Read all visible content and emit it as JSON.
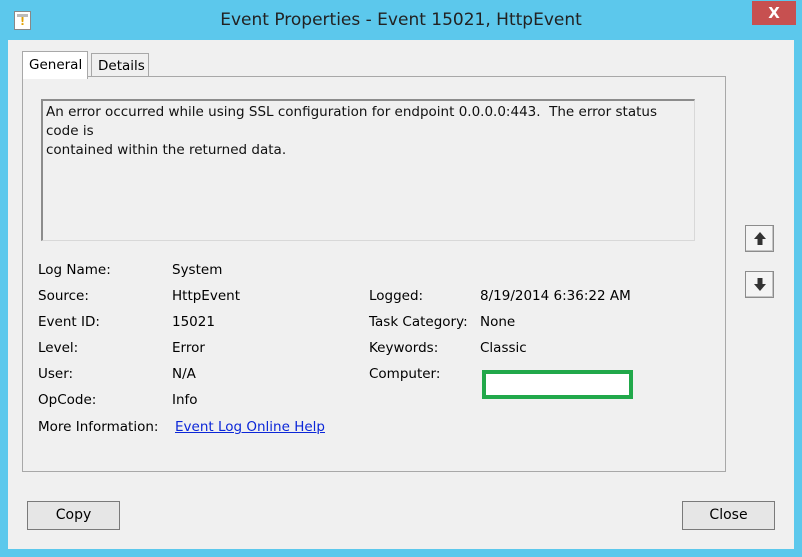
{
  "window": {
    "title": "Event Properties - Event 15021, HttpEvent",
    "close_glyph": "X",
    "app_icon": "event-viewer-icon"
  },
  "tabs": [
    {
      "label": "General",
      "active": true
    },
    {
      "label": "Details",
      "active": false
    }
  ],
  "message": "An error occurred while using SSL configuration for endpoint 0.0.0.0:443.  The error status code is\ncontained within the returned data.",
  "fields_left": [
    {
      "label": "Log Name:",
      "value": "System"
    },
    {
      "label": "Source:",
      "value": "HttpEvent"
    },
    {
      "label": "Event ID:",
      "value": "15021"
    },
    {
      "label": "Level:",
      "value": "Error"
    },
    {
      "label": "User:",
      "value": "N/A"
    },
    {
      "label": "OpCode:",
      "value": "Info"
    },
    {
      "label": "More Information:",
      "value": "Event Log Online Help"
    }
  ],
  "fields_right": [
    {
      "label": "Logged:",
      "value": "8/19/2014 6:36:22 AM"
    },
    {
      "label": "Task Category:",
      "value": "None"
    },
    {
      "label": "Keywords:",
      "value": "Classic"
    },
    {
      "label": "Computer:",
      "value": ""
    }
  ],
  "nav": {
    "up_icon": "arrow-up-icon",
    "down_icon": "arrow-down-icon"
  },
  "buttons": {
    "copy": "Copy",
    "close": "Close"
  },
  "colors": {
    "titlebar": "#5cc8ec",
    "close_button": "#c75050",
    "highlight_box": "#21a84a",
    "link": "#0b26d8"
  }
}
